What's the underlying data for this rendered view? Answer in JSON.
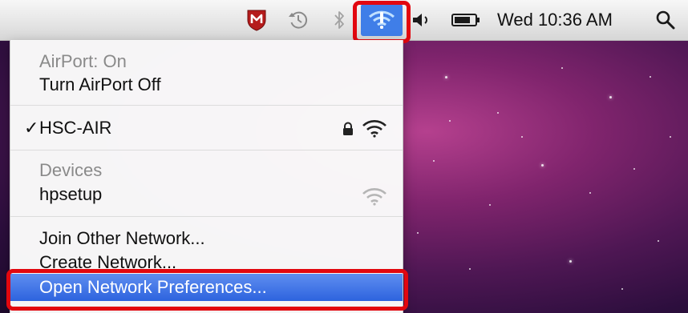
{
  "menubar": {
    "clock": "Wed 10:36 AM",
    "icons": [
      "mcafee-icon",
      "time-machine-icon",
      "bluetooth-icon",
      "wifi-icon",
      "volume-icon",
      "battery-icon",
      "spotlight-icon"
    ],
    "wifi_highlight_color": "#3f7ee8",
    "annotation_color": "#e2070f"
  },
  "menu": {
    "airport_status": "AirPort: On",
    "turn_off": "Turn AirPort Off",
    "current_network": "HSC-AIR",
    "checkmark": "✓",
    "devices_header": "Devices",
    "device_name": "hpsetup",
    "join_other": "Join Other Network...",
    "create_network": "Create Network...",
    "open_prefs": "Open Network Preferences..."
  }
}
